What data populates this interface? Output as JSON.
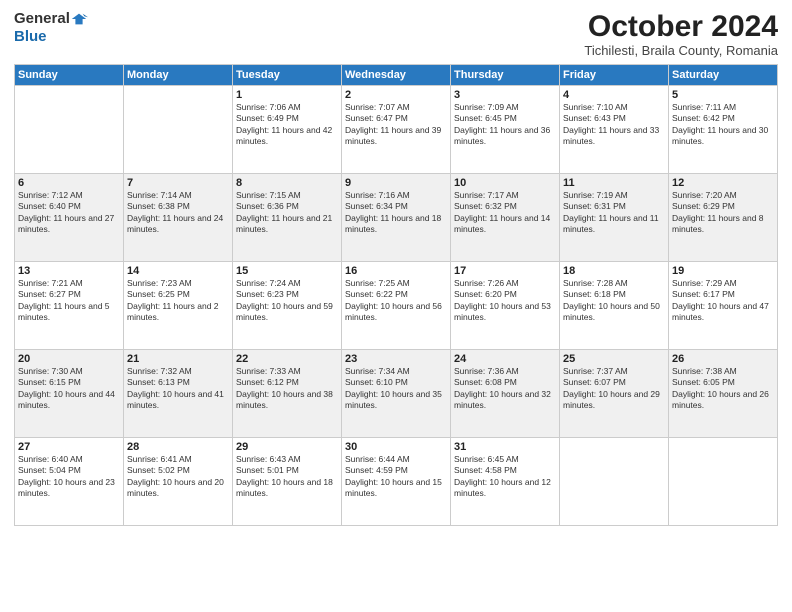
{
  "header": {
    "logo_general": "General",
    "logo_blue": "Blue",
    "month": "October 2024",
    "location": "Tichilesti, Braila County, Romania"
  },
  "days_of_week": [
    "Sunday",
    "Monday",
    "Tuesday",
    "Wednesday",
    "Thursday",
    "Friday",
    "Saturday"
  ],
  "weeks": [
    [
      {
        "day": "",
        "info": ""
      },
      {
        "day": "",
        "info": ""
      },
      {
        "day": "1",
        "info": "Sunrise: 7:06 AM\nSunset: 6:49 PM\nDaylight: 11 hours and 42 minutes."
      },
      {
        "day": "2",
        "info": "Sunrise: 7:07 AM\nSunset: 6:47 PM\nDaylight: 11 hours and 39 minutes."
      },
      {
        "day": "3",
        "info": "Sunrise: 7:09 AM\nSunset: 6:45 PM\nDaylight: 11 hours and 36 minutes."
      },
      {
        "day": "4",
        "info": "Sunrise: 7:10 AM\nSunset: 6:43 PM\nDaylight: 11 hours and 33 minutes."
      },
      {
        "day": "5",
        "info": "Sunrise: 7:11 AM\nSunset: 6:42 PM\nDaylight: 11 hours and 30 minutes."
      }
    ],
    [
      {
        "day": "6",
        "info": "Sunrise: 7:12 AM\nSunset: 6:40 PM\nDaylight: 11 hours and 27 minutes."
      },
      {
        "day": "7",
        "info": "Sunrise: 7:14 AM\nSunset: 6:38 PM\nDaylight: 11 hours and 24 minutes."
      },
      {
        "day": "8",
        "info": "Sunrise: 7:15 AM\nSunset: 6:36 PM\nDaylight: 11 hours and 21 minutes."
      },
      {
        "day": "9",
        "info": "Sunrise: 7:16 AM\nSunset: 6:34 PM\nDaylight: 11 hours and 18 minutes."
      },
      {
        "day": "10",
        "info": "Sunrise: 7:17 AM\nSunset: 6:32 PM\nDaylight: 11 hours and 14 minutes."
      },
      {
        "day": "11",
        "info": "Sunrise: 7:19 AM\nSunset: 6:31 PM\nDaylight: 11 hours and 11 minutes."
      },
      {
        "day": "12",
        "info": "Sunrise: 7:20 AM\nSunset: 6:29 PM\nDaylight: 11 hours and 8 minutes."
      }
    ],
    [
      {
        "day": "13",
        "info": "Sunrise: 7:21 AM\nSunset: 6:27 PM\nDaylight: 11 hours and 5 minutes."
      },
      {
        "day": "14",
        "info": "Sunrise: 7:23 AM\nSunset: 6:25 PM\nDaylight: 11 hours and 2 minutes."
      },
      {
        "day": "15",
        "info": "Sunrise: 7:24 AM\nSunset: 6:23 PM\nDaylight: 10 hours and 59 minutes."
      },
      {
        "day": "16",
        "info": "Sunrise: 7:25 AM\nSunset: 6:22 PM\nDaylight: 10 hours and 56 minutes."
      },
      {
        "day": "17",
        "info": "Sunrise: 7:26 AM\nSunset: 6:20 PM\nDaylight: 10 hours and 53 minutes."
      },
      {
        "day": "18",
        "info": "Sunrise: 7:28 AM\nSunset: 6:18 PM\nDaylight: 10 hours and 50 minutes."
      },
      {
        "day": "19",
        "info": "Sunrise: 7:29 AM\nSunset: 6:17 PM\nDaylight: 10 hours and 47 minutes."
      }
    ],
    [
      {
        "day": "20",
        "info": "Sunrise: 7:30 AM\nSunset: 6:15 PM\nDaylight: 10 hours and 44 minutes."
      },
      {
        "day": "21",
        "info": "Sunrise: 7:32 AM\nSunset: 6:13 PM\nDaylight: 10 hours and 41 minutes."
      },
      {
        "day": "22",
        "info": "Sunrise: 7:33 AM\nSunset: 6:12 PM\nDaylight: 10 hours and 38 minutes."
      },
      {
        "day": "23",
        "info": "Sunrise: 7:34 AM\nSunset: 6:10 PM\nDaylight: 10 hours and 35 minutes."
      },
      {
        "day": "24",
        "info": "Sunrise: 7:36 AM\nSunset: 6:08 PM\nDaylight: 10 hours and 32 minutes."
      },
      {
        "day": "25",
        "info": "Sunrise: 7:37 AM\nSunset: 6:07 PM\nDaylight: 10 hours and 29 minutes."
      },
      {
        "day": "26",
        "info": "Sunrise: 7:38 AM\nSunset: 6:05 PM\nDaylight: 10 hours and 26 minutes."
      }
    ],
    [
      {
        "day": "27",
        "info": "Sunrise: 6:40 AM\nSunset: 5:04 PM\nDaylight: 10 hours and 23 minutes."
      },
      {
        "day": "28",
        "info": "Sunrise: 6:41 AM\nSunset: 5:02 PM\nDaylight: 10 hours and 20 minutes."
      },
      {
        "day": "29",
        "info": "Sunrise: 6:43 AM\nSunset: 5:01 PM\nDaylight: 10 hours and 18 minutes."
      },
      {
        "day": "30",
        "info": "Sunrise: 6:44 AM\nSunset: 4:59 PM\nDaylight: 10 hours and 15 minutes."
      },
      {
        "day": "31",
        "info": "Sunrise: 6:45 AM\nSunset: 4:58 PM\nDaylight: 10 hours and 12 minutes."
      },
      {
        "day": "",
        "info": ""
      },
      {
        "day": "",
        "info": ""
      }
    ]
  ]
}
